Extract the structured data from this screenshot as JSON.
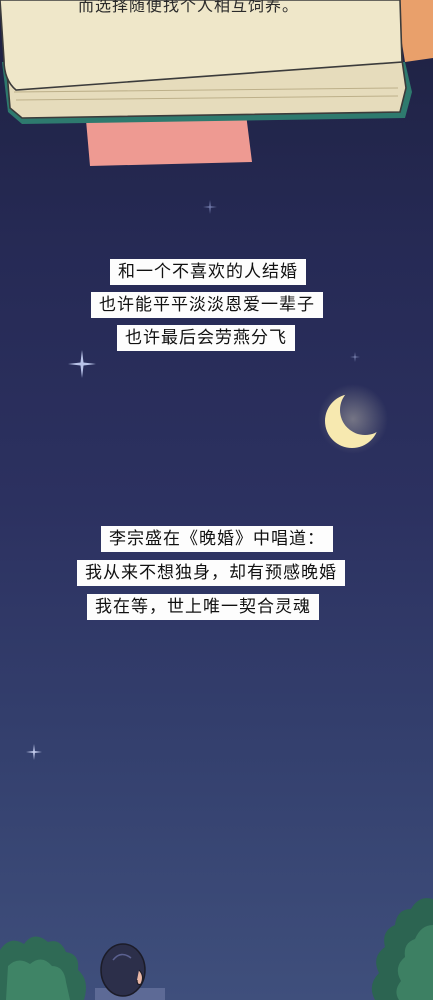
{
  "book": {
    "text_line": "而选择随便找个人相互饲养。"
  },
  "captions_group1": [
    "和一个不喜欢的人结婚",
    "也许能平平淡淡恩爱一辈子",
    "也许最后会劳燕分飞"
  ],
  "captions_group2": [
    "李宗盛在《晚婚》中唱道：",
    "我从来不想独身，却有预感晚婚",
    "我在等，世上唯一契合灵魂"
  ],
  "icons": [
    "moon-icon",
    "sparkle-star-icon",
    "tree-illustration",
    "person-illustration"
  ],
  "colors": {
    "sky_top": "#1e2141",
    "sky_bottom": "#3f4f7c",
    "book_page": "#efe7c9",
    "book_edge": "#2e7a6e",
    "sticky_note": "#ee9a92",
    "moon": "#f7e9b0"
  }
}
